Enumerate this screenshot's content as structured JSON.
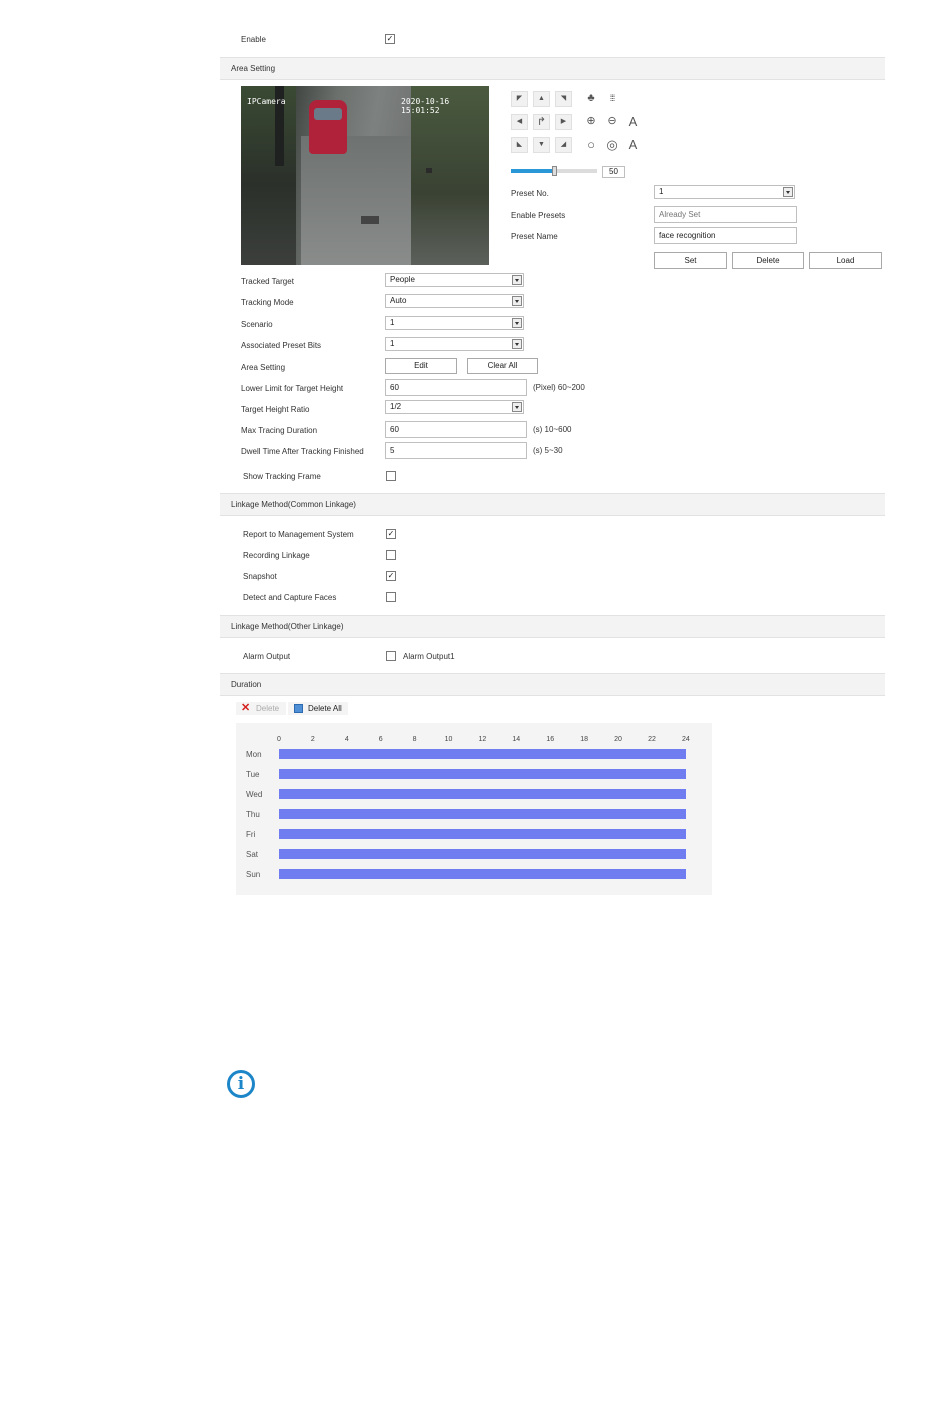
{
  "enable": {
    "label": "Enable",
    "checked": true
  },
  "sections": {
    "area_setting": "Area Setting",
    "common_linkage": "Linkage Method(Common Linkage)",
    "other_linkage": "Linkage Method(Other Linkage)",
    "duration": "Duration"
  },
  "video": {
    "channel_label": "IPCamera",
    "timestamp": "2020-10-16 15:01:52"
  },
  "ptz": {
    "zoom_value": "50",
    "zoom_fraction": 0.5,
    "preset_no_label": "Preset No.",
    "preset_no_value": "1",
    "enable_presets_label": "Enable Presets",
    "enable_presets_placeholder": "Already Set",
    "preset_name_label": "Preset Name",
    "preset_name_value": "face recognition",
    "set_label": "Set",
    "delete_label": "Delete",
    "load_label": "Load",
    "icons": [
      "up-left-arrow-icon",
      "up-arrow-icon",
      "up-right-arrow-icon",
      "focus-near-icon",
      "focus-far-icon",
      "left-arrow-icon",
      "rotate-icon",
      "right-arrow-icon",
      "zoom-in-icon",
      "zoom-out-icon",
      "auto-icon",
      "down-left-arrow-icon",
      "down-arrow-icon",
      "down-right-arrow-icon",
      "iris-open-icon",
      "iris-close-icon",
      "auto-iris-icon"
    ]
  },
  "form": {
    "tracked_target_label": "Tracked Target",
    "tracked_target_value": "People",
    "tracking_mode_label": "Tracking Mode",
    "tracking_mode_value": "Auto",
    "scenario_label": "Scenario",
    "scenario_value": "1",
    "assoc_preset_label": "Associated Preset Bits",
    "assoc_preset_value": "1",
    "area_setting_label": "Area Setting",
    "edit_label": "Edit",
    "clear_all_label": "Clear All",
    "lower_limit_label": "Lower Limit for Target Height",
    "lower_limit_value": "60",
    "lower_limit_unit": "(Pixel)  60~200",
    "height_ratio_label": "Target Height Ratio",
    "height_ratio_value": "1/2",
    "max_duration_label": "Max Tracing Duration",
    "max_duration_value": "60",
    "max_duration_unit": "(s)  10~600",
    "dwell_label": "Dwell Time After Tracking Finished",
    "dwell_value": "5",
    "dwell_unit": "(s)  5~30",
    "show_frame_label": "Show Tracking Frame",
    "show_frame_checked": false
  },
  "common_linkage": {
    "report_label": "Report to Management System",
    "report_checked": true,
    "recording_label": "Recording Linkage",
    "recording_checked": false,
    "snapshot_label": "Snapshot",
    "snapshot_checked": true,
    "faces_label": "Detect and Capture Faces",
    "faces_checked": false
  },
  "other_linkage": {
    "alarm_output_label": "Alarm Output",
    "alarm_output1_label": "Alarm Output1",
    "alarm_output1_checked": false
  },
  "duration": {
    "delete_label": "Delete",
    "delete_all_label": "Delete All",
    "hours": [
      "0",
      "2",
      "4",
      "6",
      "8",
      "10",
      "12",
      "14",
      "16",
      "18",
      "20",
      "22",
      "24"
    ],
    "days": [
      "Mon",
      "Tue",
      "Wed",
      "Thu",
      "Fri",
      "Sat",
      "Sun"
    ],
    "schedule_color": "#6f7df0"
  },
  "note_icon": "info-icon"
}
